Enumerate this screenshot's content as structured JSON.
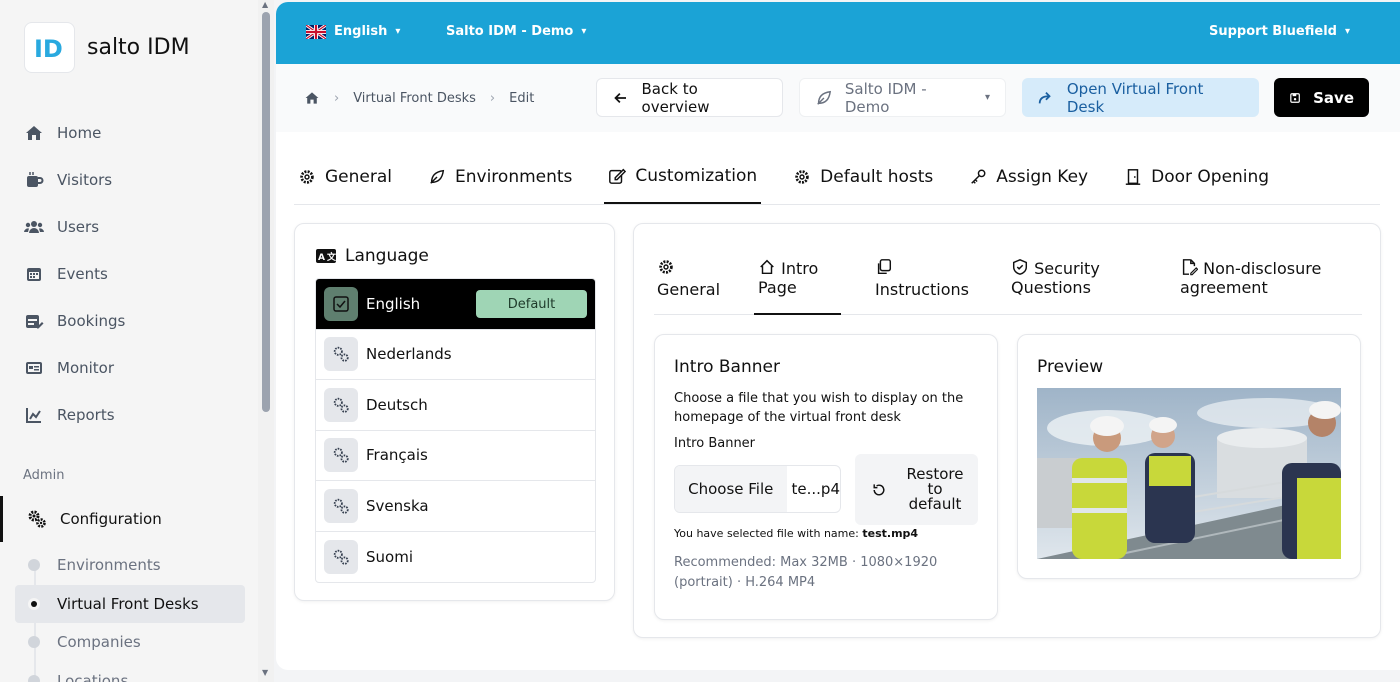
{
  "app": {
    "name": "salto IDM",
    "logo_glyph": "ID"
  },
  "sidebar": {
    "items": [
      {
        "label": "Home",
        "icon": "home-icon"
      },
      {
        "label": "Visitors",
        "icon": "mug-icon"
      },
      {
        "label": "Users",
        "icon": "users-icon"
      },
      {
        "label": "Events",
        "icon": "calendar-icon"
      },
      {
        "label": "Bookings",
        "icon": "calendar-edit-icon"
      },
      {
        "label": "Monitor",
        "icon": "monitor-icon"
      },
      {
        "label": "Reports",
        "icon": "chart-icon"
      }
    ],
    "section_label": "Admin",
    "config_label": "Configuration",
    "sub_items": [
      {
        "label": "Environments"
      },
      {
        "label": "Virtual Front Desks"
      },
      {
        "label": "Companies"
      },
      {
        "label": "Locations"
      }
    ]
  },
  "topbar": {
    "language": "English",
    "organization": "Salto IDM - Demo",
    "user": "Support Bluefield",
    "bg_color": "#1ba3d6"
  },
  "actionbar": {
    "breadcrumb": [
      "Virtual Front Desks",
      "Edit"
    ],
    "back_label": "Back to overview",
    "env_select": "Salto IDM - Demo",
    "open_label": "Open Virtual Front Desk",
    "save_label": "Save"
  },
  "tabs": [
    {
      "label": "General",
      "icon": "gear-icon"
    },
    {
      "label": "Environments",
      "icon": "leaf-icon"
    },
    {
      "label": "Customization",
      "icon": "edit-icon",
      "active": true
    },
    {
      "label": "Default hosts",
      "icon": "gear-icon"
    },
    {
      "label": "Assign Key",
      "icon": "key-icon"
    },
    {
      "label": "Door Opening",
      "icon": "door-icon"
    }
  ],
  "language_panel": {
    "title": "Language",
    "default_badge": "Default",
    "languages": [
      "English",
      "Nederlands",
      "Deutsch",
      "Français",
      "Svenska",
      "Suomi"
    ]
  },
  "subtabs": [
    {
      "line1": "General",
      "line2": "",
      "icon": "gear-icon"
    },
    {
      "line1": "Intro",
      "line2": "Page",
      "icon": "home-icon",
      "active": true
    },
    {
      "line1": "Instructions",
      "line2": "",
      "icon": "copy-icon"
    },
    {
      "line1": "Security",
      "line2": "Questions",
      "icon": "shield-icon"
    },
    {
      "line1": "Non-disclosure",
      "line2": "agreement",
      "icon": "file-edit-icon"
    }
  ],
  "intro_banner": {
    "title": "Intro Banner",
    "description": "Choose a file that you wish to display on the homepage of the virtual front desk",
    "field_label": "Intro Banner",
    "choose_file": "Choose File",
    "file_display": "te...p4",
    "restore_label": "Restore to default",
    "selected_prefix": "You have selected file with name:",
    "selected_file": "test.mp4",
    "recommendation": "Recommended: Max 32MB · 1080×1920 (portrait) · H.264 MP4"
  },
  "preview": {
    "title": "Preview"
  }
}
